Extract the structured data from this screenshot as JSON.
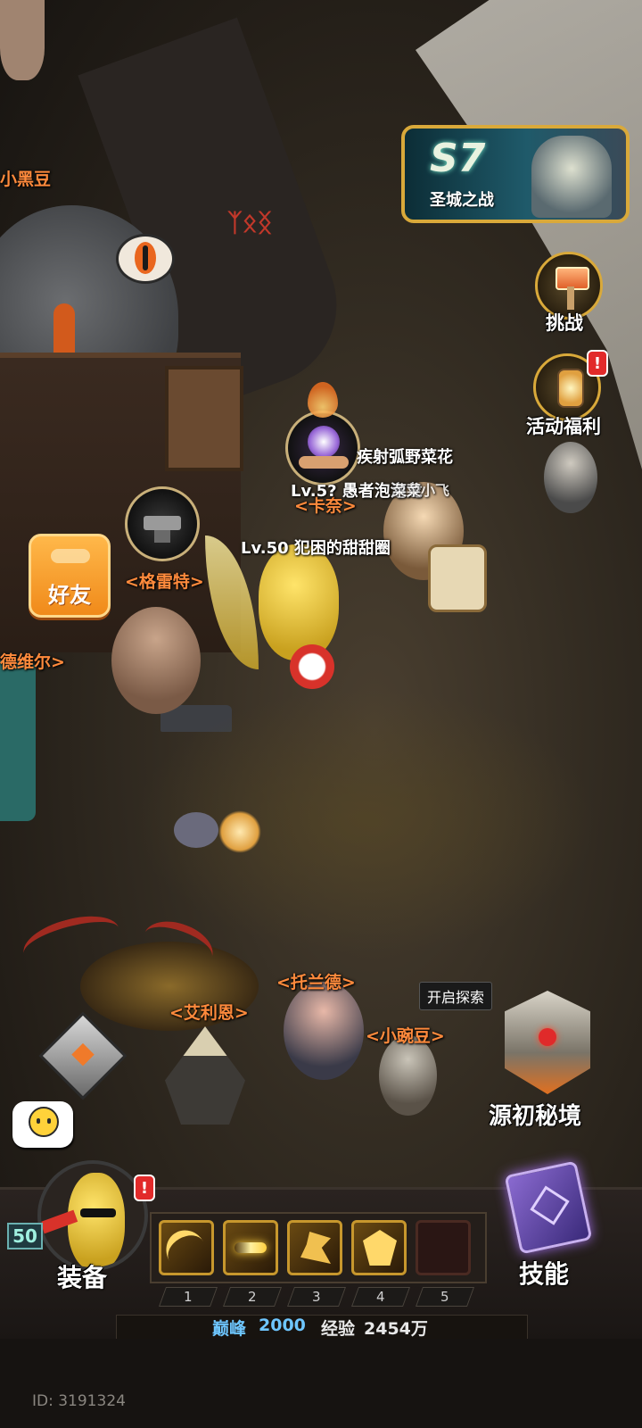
{
  "season": {
    "code": "S7",
    "name": "圣城之战"
  },
  "side_buttons": [
    {
      "label": "挑战"
    },
    {
      "label": "活动福利",
      "alert": "!"
    }
  ],
  "friends_button": {
    "label": "好友"
  },
  "npc_labels": {
    "geleite": "<格雷特>",
    "kanai": "<卡奈>",
    "tuolande": "<托兰德>",
    "ailien": "<艾利恩>",
    "xiaowandou": "<小豌豆>",
    "deweier": "德维尔>",
    "xiaoheidou": "小黑豆"
  },
  "player_labels": {
    "self": "Lv.50 犯困的甜甜圈",
    "other1": "Lv.5? 愚者泡泡龙",
    "other2": "疾射弧野菜花",
    "other3": "菜菜小飞"
  },
  "explore": {
    "tooltip": "开启探索",
    "label": "源初秘境"
  },
  "bottom_bar": {
    "equip_label": "装备",
    "equip_alert": "!",
    "level": "50",
    "skills_label": "技能",
    "slots": [
      "1",
      "2",
      "3",
      "4",
      "5"
    ],
    "peak_label": "巅峰",
    "peak_value": "2000",
    "exp_label": "经验",
    "exp_value": "2454万"
  },
  "chat_icon": "cat-face-icon",
  "footer": {
    "id_text": "ID: 3191324"
  },
  "colors": {
    "npc_name": "#ff8a3c",
    "gold_frame": "#c7972d",
    "peak_blue": "#6ec6ff",
    "alert_red": "#e22a2a"
  }
}
